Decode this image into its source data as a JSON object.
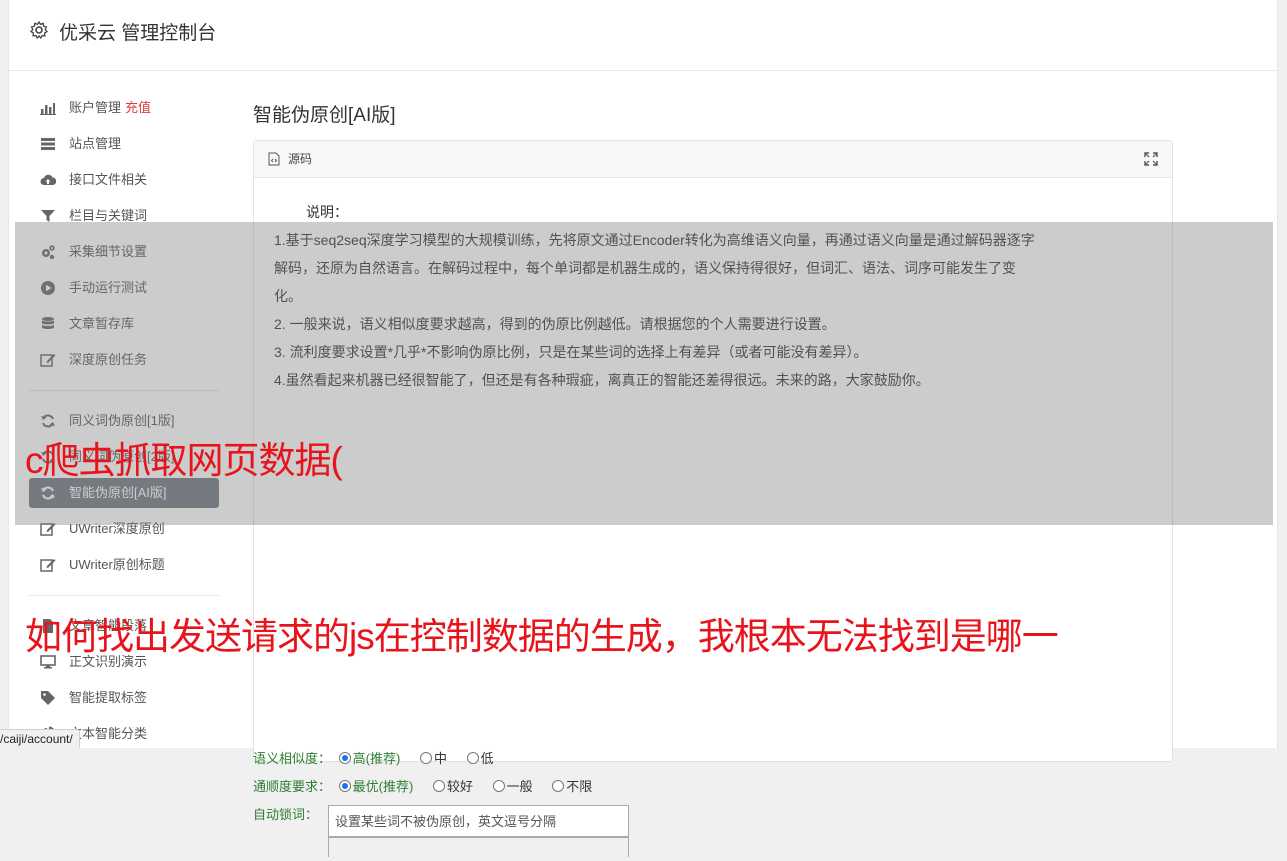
{
  "header": {
    "title": "优采云 管理控制台"
  },
  "sidebar": {
    "group1": [
      {
        "label": "账户管理",
        "tag": "充值",
        "icon": "bar-chart-icon"
      },
      {
        "label": "站点管理",
        "icon": "list-icon"
      },
      {
        "label": "接口文件相关",
        "icon": "cloud-upload-icon"
      },
      {
        "label": "栏目与关键词",
        "icon": "filter-icon"
      },
      {
        "label": "采集细节设置",
        "icon": "cogs-icon"
      },
      {
        "label": "手动运行测试",
        "icon": "play-circle-icon"
      },
      {
        "label": "文章暂存库",
        "icon": "database-icon"
      },
      {
        "label": "深度原创任务",
        "icon": "edit-icon"
      }
    ],
    "group2": [
      {
        "label": "同义词伪原创[1版]",
        "icon": "refresh-icon"
      },
      {
        "label": "同义词伪原创[2版]",
        "icon": "refresh-icon"
      },
      {
        "label": "智能伪原创[AI版]",
        "icon": "refresh-icon",
        "active": true
      },
      {
        "label": "UWriter深度原创",
        "icon": "edit-icon"
      },
      {
        "label": "UWriter原创标题",
        "icon": "edit-icon"
      }
    ],
    "group3": [
      {
        "label": "文章智能段落",
        "icon": "file-icon"
      },
      {
        "label": "正文识别演示",
        "icon": "monitor-icon"
      },
      {
        "label": "智能提取标签",
        "icon": "tag-icon"
      },
      {
        "label": "文本智能分类",
        "icon": "pie-chart-icon"
      }
    ]
  },
  "main": {
    "page_title": "智能伪原创[AI版]",
    "panel": {
      "head_label": "源码",
      "label": "说明：",
      "lines": [
        "1.基于seq2seq深度学习模型的大规模训练，先将原文通过Encoder转化为高维语义向量，再通过语义向量是通过解码器逐字",
        "解码，还原为自然语言。在解码过程中，每个单词都是机器生成的，语义保持得很好，但词汇、语法、词序可能发生了变",
        "化。",
        "2. 一般来说，语义相似度要求越高，得到的伪原比例越低。请根据您的个人需要进行设置。",
        "3. 流利度要求设置*几乎*不影响伪原比例，只是在某些词的选择上有差异（或者可能没有差异）。",
        "4.虽然看起来机器已经很智能了，但还是有各种瑕疵，离真正的智能还差得很远。未来的路，大家鼓励你。"
      ]
    },
    "form": {
      "similarity": {
        "label": "语义相似度：",
        "options": [
          "高(推荐)",
          "中",
          "低"
        ],
        "selected": 0
      },
      "fluency": {
        "label": "通顺度要求：",
        "options": [
          "最优(推荐)",
          "较好",
          "一般",
          "不限"
        ],
        "selected": 0
      },
      "lock": {
        "label": "自动锁词：",
        "placeholder": "设置某些词不被伪原创，英文逗号分隔"
      }
    }
  },
  "overlay": {
    "text1": "c爬虫抓取网页数据(",
    "text2": "如何找出发送请求的js在控制数据的生成，我根本无法找到是哪一"
  },
  "status": {
    "url": "/caiji/account/"
  }
}
